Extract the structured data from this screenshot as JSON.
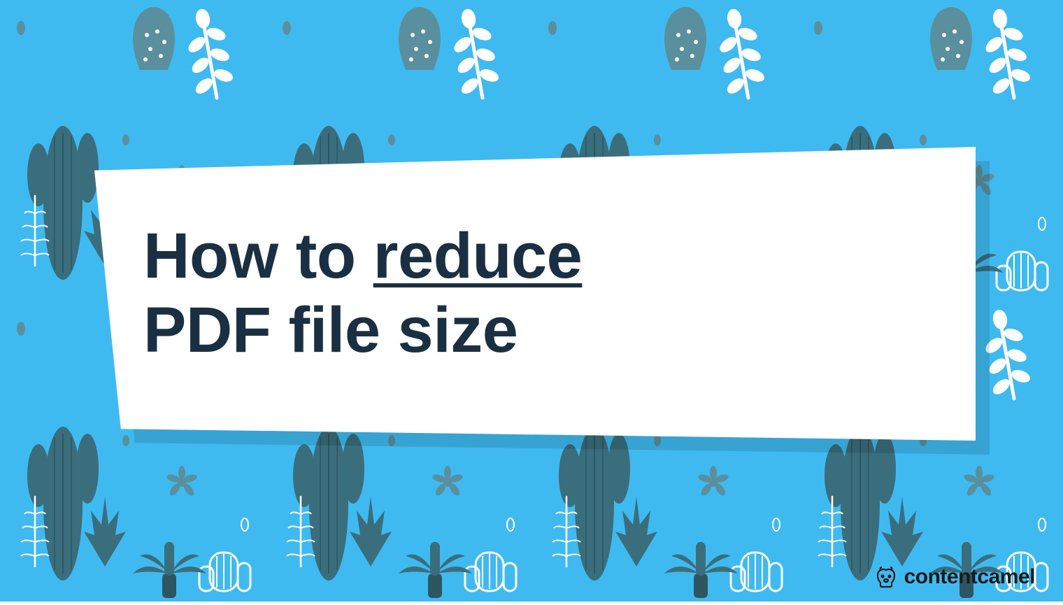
{
  "headline": {
    "prefix": "How to ",
    "underlined": "reduce",
    "line2": "PDF file size"
  },
  "brand": {
    "name_part1": "content",
    "name_part2": "camel"
  },
  "colors": {
    "background": "#3fbaf0",
    "text": "#1a3042",
    "card": "#ffffff",
    "logo": "#1a1a1a",
    "cactus_dark": "#3a6e7d",
    "cactus_light": "#5a8f9e",
    "accent_white": "#ffffff"
  }
}
